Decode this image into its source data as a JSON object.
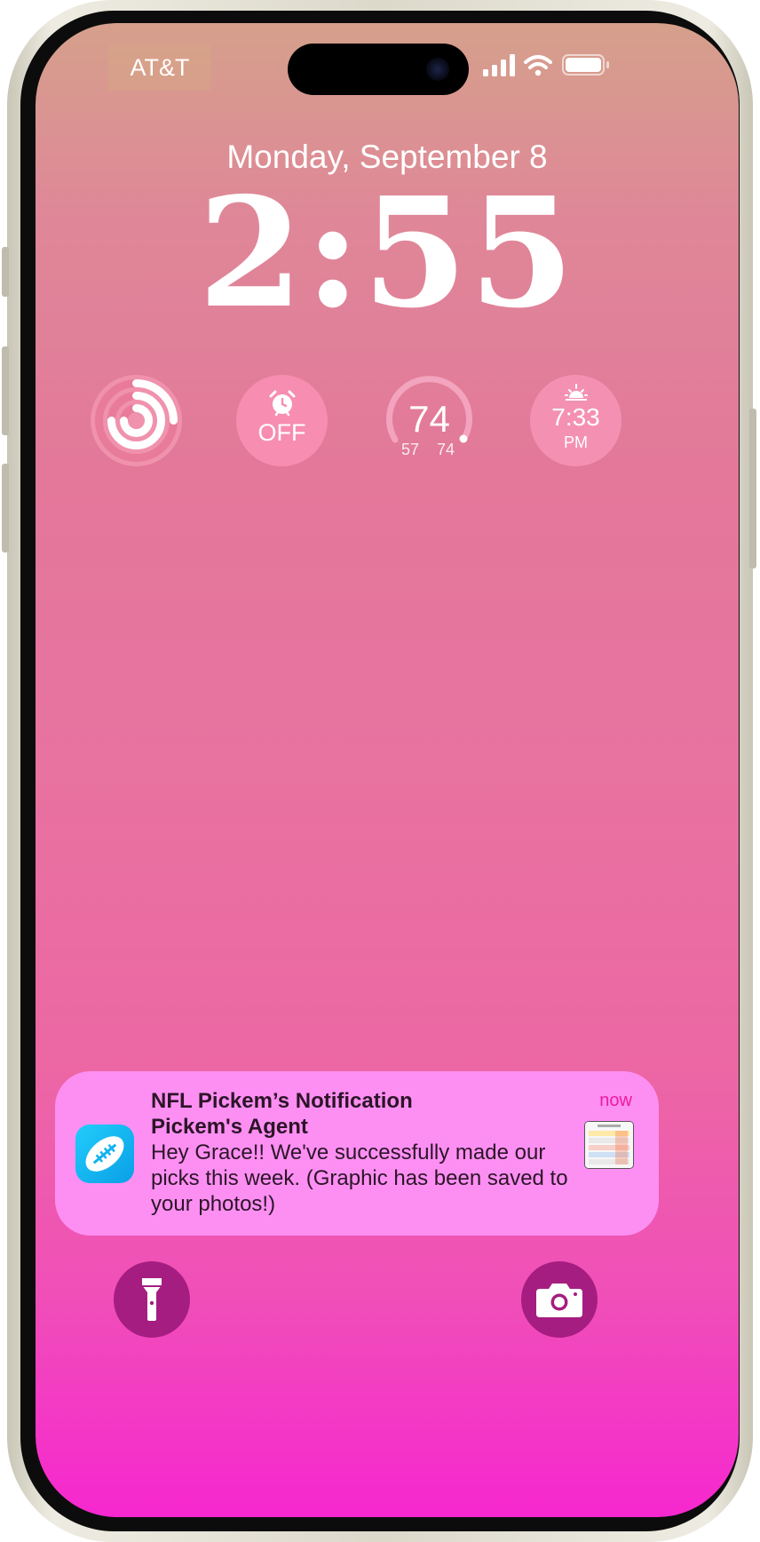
{
  "status_bar": {
    "carrier": "AT&T",
    "signal_icon": "cellular-signal-icon",
    "wifi_icon": "wifi-icon",
    "battery_icon": "battery-icon"
  },
  "lock_screen": {
    "date": "Monday, September 8",
    "time": "2:55"
  },
  "widgets": {
    "activity": {
      "icon": "activity-rings-icon"
    },
    "alarm": {
      "icon": "alarm-clock-icon",
      "label": "OFF"
    },
    "weather": {
      "temperature": "74",
      "low": "57",
      "high": "74"
    },
    "sunset": {
      "icon": "sunset-icon",
      "time": "7:33",
      "period": "PM"
    }
  },
  "notification": {
    "app_icon": "football-icon",
    "title": "NFL Pickem’s Notification",
    "subtitle": "Pickem's Agent",
    "body": "Hey Grace!! We've successfully made our picks this week. (Graphic has been saved to your photos!)",
    "time": "now"
  },
  "quick_actions": {
    "flashlight_icon": "flashlight-icon",
    "camera_icon": "camera-icon"
  },
  "colors": {
    "notification_bg": "#fd8ff3",
    "notification_time": "#ee1b9a",
    "quick_action_bg": "#a61d81",
    "app_icon": "#0aa8ee"
  }
}
